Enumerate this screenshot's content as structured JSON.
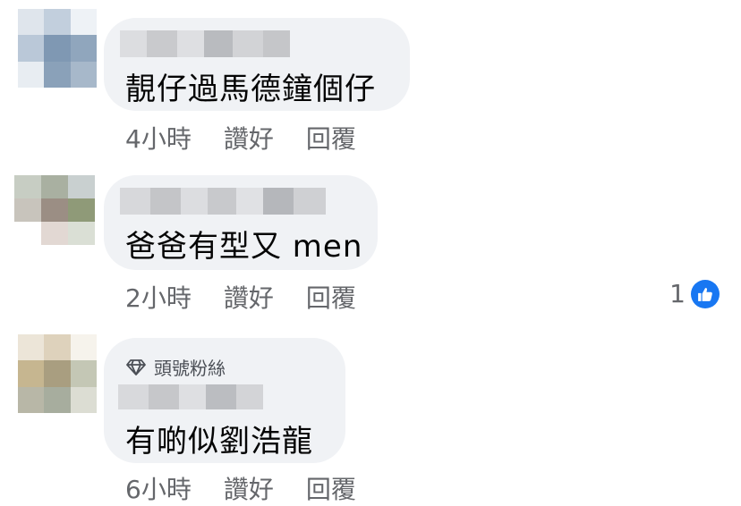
{
  "comments": [
    {
      "text": "靚仔過馬德鐘個仔",
      "time": "4小時",
      "like_label": "讚好",
      "reply_label": "回覆"
    },
    {
      "text": "爸爸有型又 men",
      "time": "2小時",
      "like_label": "讚好",
      "reply_label": "回覆",
      "reaction_count": "1",
      "reaction_icon": "thumbs-up-icon"
    },
    {
      "badge": "頭號粉絲",
      "badge_icon": "diamond-icon",
      "text": "有啲似劉浩龍",
      "time": "6小時",
      "like_label": "讚好",
      "reply_label": "回覆"
    }
  ],
  "colors": {
    "bubble": "#f0f2f5",
    "meta_text": "#65676b",
    "like_blue": "#1877f2"
  }
}
